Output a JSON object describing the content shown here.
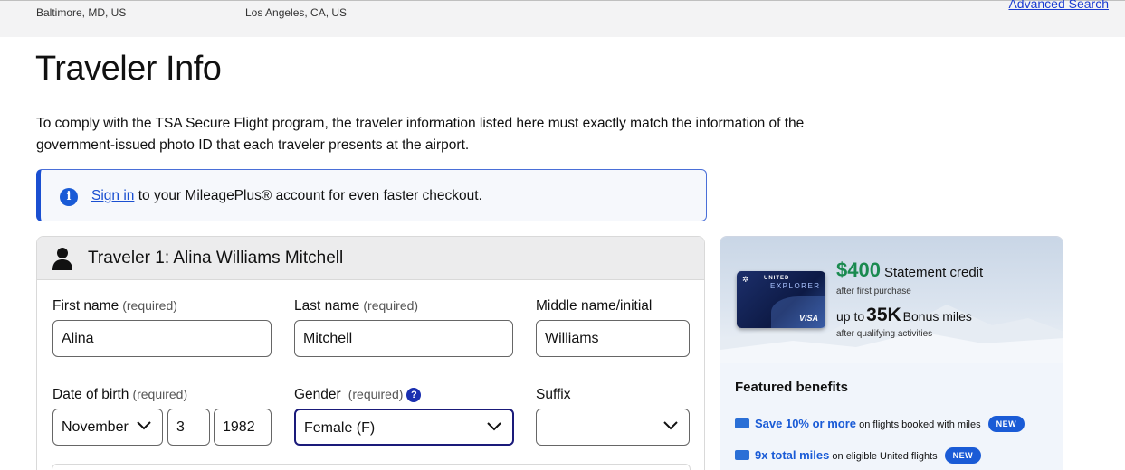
{
  "top_bar": {
    "origin_city": "Baltimore, MD, US",
    "destination_city": "Los Angeles, CA, US",
    "advanced_search": "Advanced Search"
  },
  "page": {
    "title": "Traveler Info",
    "intro": "To comply with the TSA Secure Flight program, the traveler information listed here must exactly match the information of the government-issued photo ID that each traveler presents at the airport."
  },
  "notice": {
    "icon": "info-icon",
    "link": "Sign in",
    "text": " to your MileagePlus® account for even faster checkout."
  },
  "traveler": {
    "heading": "Traveler 1: Alina Williams Mitchell",
    "fields": {
      "first_name_label": "First name",
      "last_name_label": "Last name",
      "middle_name_label": "Middle name/initial",
      "dob_label": "Date of birth",
      "gender_label": "Gender",
      "suffix_label": "Suffix",
      "required": "(required)",
      "gender_help": "?",
      "first_name": "Alina",
      "last_name": "Mitchell",
      "middle_name": "Williams",
      "dob_month": "November",
      "dob_day": "3",
      "dob_year": "1982",
      "gender": "Female (F)",
      "suffix": ""
    }
  },
  "promo": {
    "card": {
      "brand": "UNITED",
      "product": "EXPLORER",
      "network": "VISA"
    },
    "offer1_amount": "$400",
    "offer1_text": "Statement credit",
    "offer1_sub": "after first purchase",
    "offer2_pre": "up to",
    "offer2_amount": "35K",
    "offer2_text": "Bonus miles",
    "offer2_sub": "after qualifying activities",
    "featured_title": "Featured benefits",
    "benefits": [
      {
        "highlight": "Save 10% or more",
        "text": " on flights booked with miles",
        "badge": "NEW"
      },
      {
        "highlight": "9x total miles",
        "text": " on eligible United flights",
        "badge": "NEW"
      }
    ]
  },
  "colors": {
    "accent": "#1a4fd1",
    "promo_green": "#1a8a4f",
    "focus_border": "#1a1a7a"
  }
}
